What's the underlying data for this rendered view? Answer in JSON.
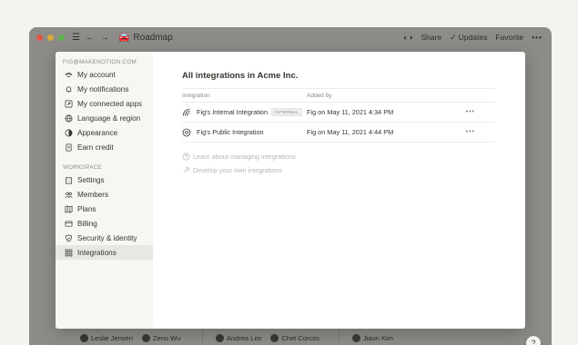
{
  "window": {
    "title": "Roadmap",
    "toolbar": {
      "share": "Share",
      "updates": "Updates",
      "favorite": "Favorite",
      "more": "•••"
    }
  },
  "background": {
    "people": [
      "Leslie Jensen",
      "Zeno Wu",
      "Andrea Lim",
      "Chet Corcos",
      "Jiaun Kim"
    ],
    "help": "?"
  },
  "sidebar": {
    "email": "FIG@MAKENOTION.COM",
    "account_items": [
      {
        "label": "My account",
        "icon": "face-icon"
      },
      {
        "label": "My notifications",
        "icon": "bell-icon"
      },
      {
        "label": "My connected apps",
        "icon": "connected-apps-icon"
      },
      {
        "label": "Language & region",
        "icon": "globe-icon"
      },
      {
        "label": "Appearance",
        "icon": "appearance-icon"
      },
      {
        "label": "Earn credit",
        "icon": "credit-icon"
      }
    ],
    "workspace_title": "WORKSPACE",
    "workspace_items": [
      {
        "label": "Settings",
        "icon": "building-icon"
      },
      {
        "label": "Members",
        "icon": "members-icon"
      },
      {
        "label": "Plans",
        "icon": "map-icon"
      },
      {
        "label": "Billing",
        "icon": "card-icon"
      },
      {
        "label": "Security & identity",
        "icon": "shield-icon"
      },
      {
        "label": "Integrations",
        "icon": "grid-icon",
        "active": true
      }
    ]
  },
  "main": {
    "title": "All integrations in Acme Inc.",
    "columns": [
      "Integration",
      "Added by"
    ],
    "rows": [
      {
        "name": "Fig's Internal Integration",
        "badge": "INTERNAL",
        "added_by": "Fig on May 11, 2021 4:34 PM",
        "more": "•••"
      },
      {
        "name": "Fig's Public Integration",
        "badge": "",
        "added_by": "Fig on May 11, 2021 4:44 PM",
        "more": "•••"
      }
    ],
    "links": [
      {
        "label": "Learn about managing integrations",
        "icon": "question-circle-icon"
      },
      {
        "label": "Develop your own integrations",
        "icon": "arrow-up-right-icon"
      }
    ]
  },
  "colors": {
    "sidebar_bg": "#f7f6f3",
    "active_item_bg": "#e8e7e3",
    "text": "#37352f",
    "muted": "#8b8a86"
  }
}
